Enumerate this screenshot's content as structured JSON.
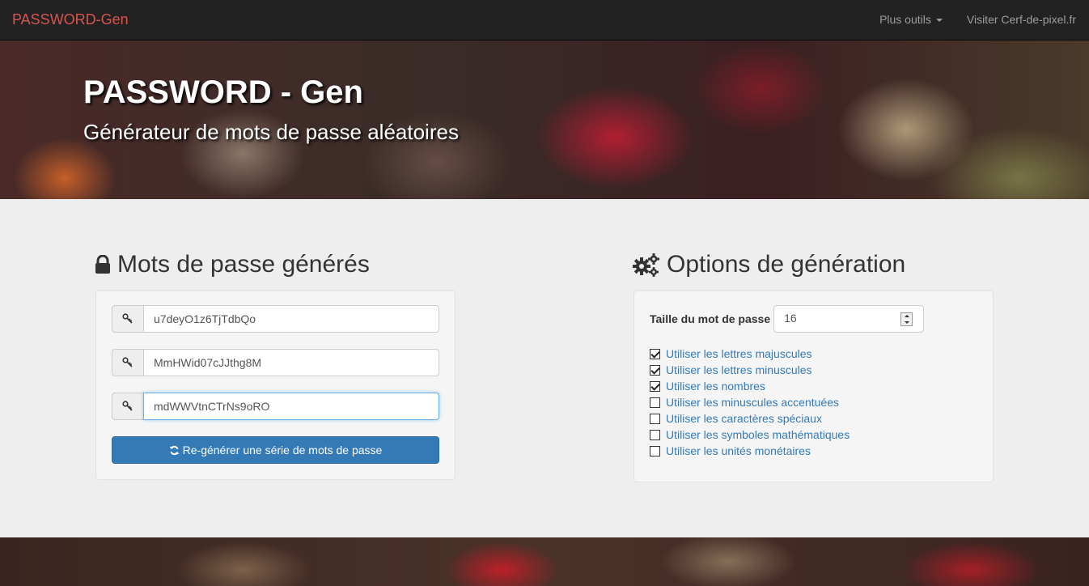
{
  "navbar": {
    "brand": "PASSWORD-Gen",
    "more_tools": "Plus outils",
    "visit_link": "Visiter Cerf-de-pixel.fr"
  },
  "hero": {
    "title": "PASSWORD - Gen",
    "subtitle": "Générateur de mots de passe aléatoires"
  },
  "passwords": {
    "heading": "Mots de passe générés",
    "icon": "lock-icon",
    "items": [
      "u7deyO1z6TjTdbQo",
      "MmHWid07cJJthg8M",
      "mdWWVtnCTrNs9oRO"
    ],
    "regenerate_label": "Re-générer une série de mots de passe"
  },
  "options": {
    "heading": "Options de génération",
    "icon": "gears-icon",
    "size_label": "Taille du mot de passe",
    "size_value": "16",
    "checkboxes": [
      {
        "label": "Utiliser les lettres majuscules",
        "checked": true
      },
      {
        "label": "Utiliser les lettres minuscules",
        "checked": true
      },
      {
        "label": "Utiliser les nombres",
        "checked": true
      },
      {
        "label": "Utiliser les minuscules accentuées",
        "checked": false
      },
      {
        "label": "Utiliser les caractères spéciaux",
        "checked": false
      },
      {
        "label": "Utiliser les symboles mathématiques",
        "checked": false
      },
      {
        "label": "Utiliser les unités monétaires",
        "checked": false
      }
    ]
  }
}
